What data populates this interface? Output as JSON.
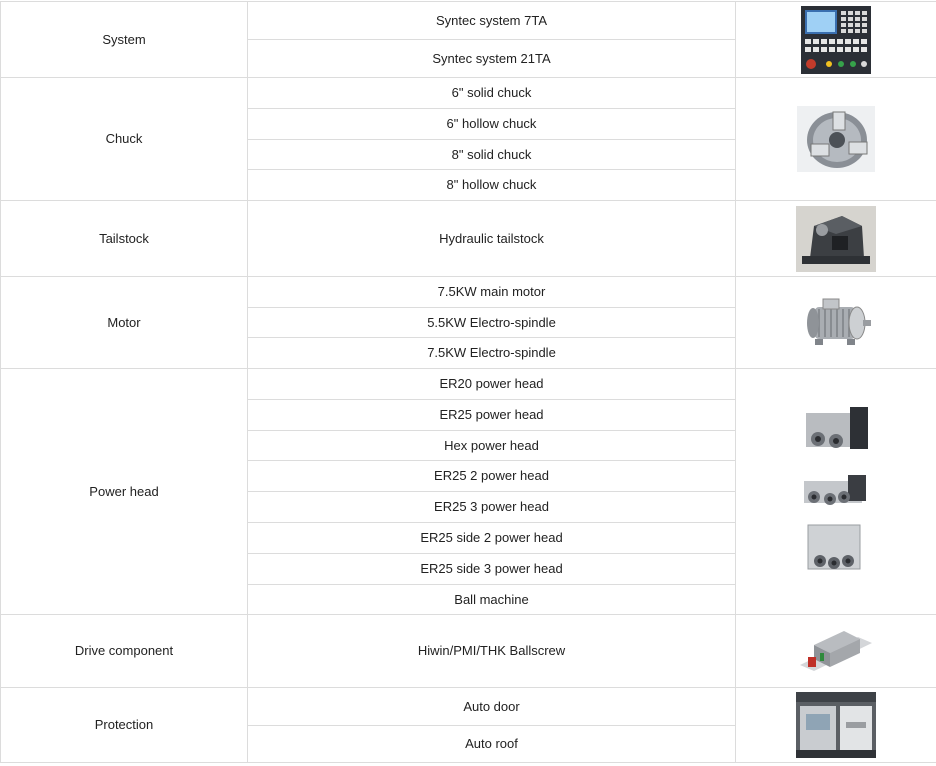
{
  "rows": [
    {
      "category": "System",
      "options": [
        "Syntec system 7TA",
        "Syntec system 21TA"
      ],
      "image": "cnc-controller-panel"
    },
    {
      "category": "Chuck",
      "options": [
        "6\" solid chuck",
        "6\" hollow chuck",
        "8\" solid chuck",
        "8\" hollow chuck"
      ],
      "image": "hydraulic-chuck"
    },
    {
      "category": "Tailstock",
      "options": [
        "Hydraulic tailstock"
      ],
      "image": "hydraulic-tailstock"
    },
    {
      "category": "Motor",
      "options": [
        "7.5KW main motor",
        "5.5KW Electro-spindle",
        "7.5KW Electro-spindle"
      ],
      "image": "electric-motor"
    },
    {
      "category": "Power head",
      "options": [
        "ER20 power head",
        "ER25 power head",
        "Hex power head",
        "ER25 2 power head",
        "ER25 3 power head",
        "ER25 side 2 power head",
        "ER25 side 3 power head",
        "Ball machine"
      ],
      "image": "power-heads"
    },
    {
      "category": "Drive component",
      "options": [
        "Hiwin/PMI/THK Ballscrew"
      ],
      "image": "linear-guide-block"
    },
    {
      "category": "Protection",
      "options": [
        "Auto door",
        "Auto roof"
      ],
      "image": "machine-enclosure"
    }
  ]
}
